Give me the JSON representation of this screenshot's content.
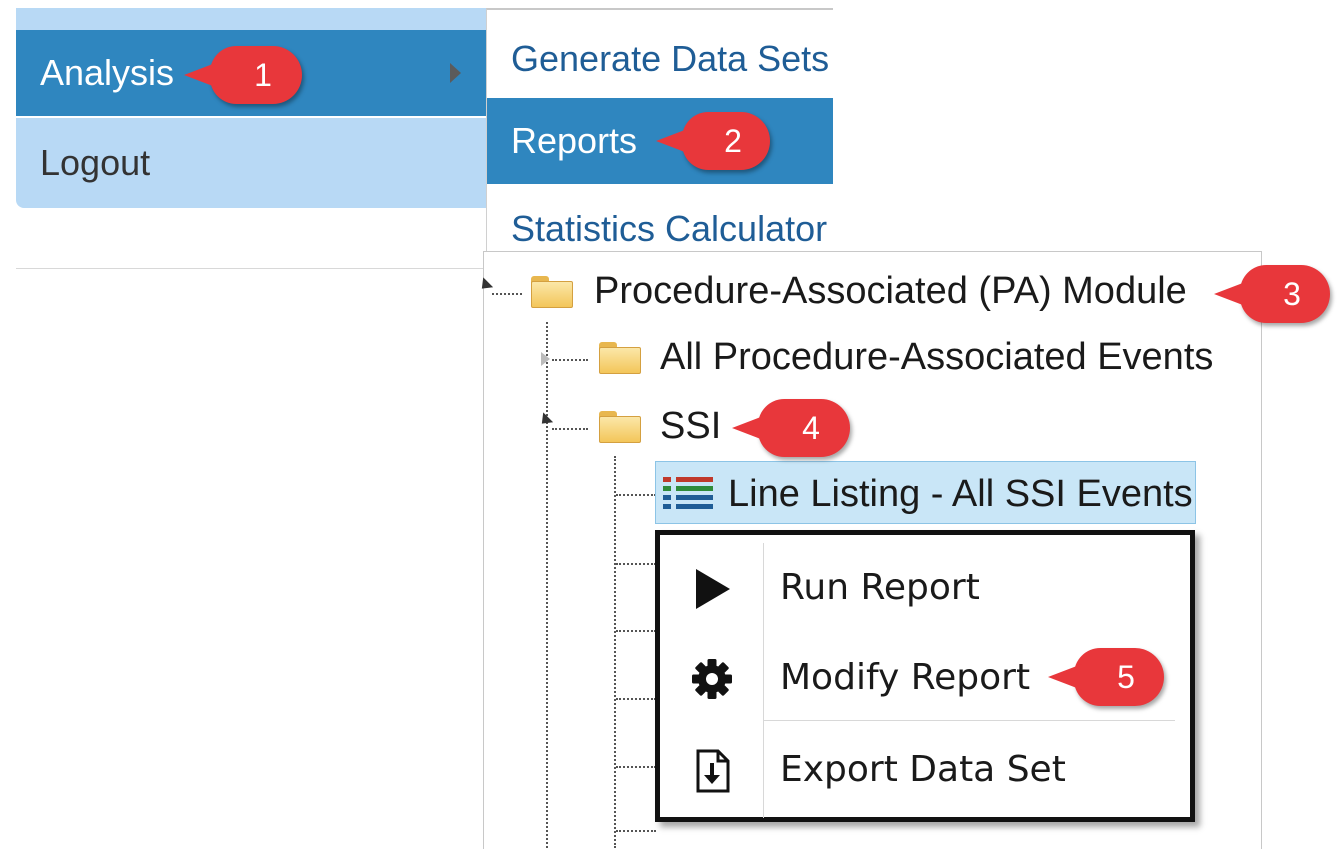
{
  "nav": {
    "analysis_label": "Analysis",
    "logout_label": "Logout"
  },
  "submenu": {
    "items": [
      "Generate Data Sets",
      "Reports",
      "Statistics Calculator"
    ],
    "selected": "Reports"
  },
  "tree": {
    "root": "Procedure-Associated (PA) Module",
    "all_events": "All Procedure-Associated Events",
    "ssi": "SSI",
    "selected_report": "Line Listing - All SSI Events"
  },
  "context_menu": {
    "run": "Run Report",
    "modify": "Modify Report",
    "export": "Export Data Set"
  },
  "callouts": [
    "1",
    "2",
    "3",
    "4",
    "5"
  ],
  "colors": {
    "nav_active": "#2f86bf",
    "nav_inactive": "#b8d9f5",
    "link": "#1f5d96",
    "callout": "#e8373b",
    "selection": "#c9e6f7"
  },
  "icons": [
    "folder-icon",
    "play-icon",
    "gear-icon",
    "export-file-icon",
    "line-listing-icon"
  ]
}
